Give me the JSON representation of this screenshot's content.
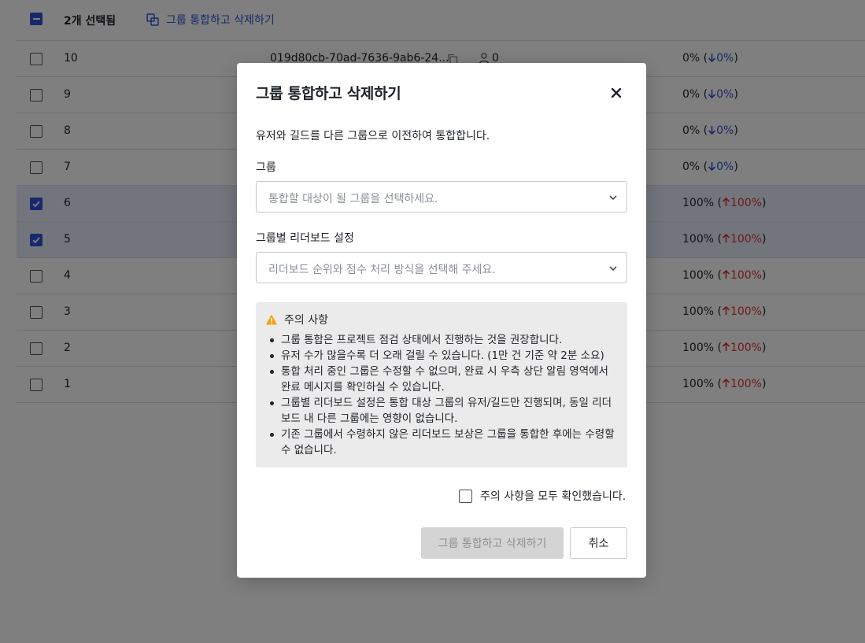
{
  "toolbar": {
    "selected_count": "2개 선택됨",
    "merge_action": "그룹 통합하고 삭제하기"
  },
  "rows": [
    {
      "num": "10",
      "uuid": "019d80cb-70ad-7636-9ab6-24...",
      "users": "0",
      "rate": "0% (",
      "change": "0%",
      "direction": "down",
      "selected": false
    },
    {
      "num": "9",
      "rate": "0% (",
      "change": "0%",
      "direction": "down",
      "selected": false
    },
    {
      "num": "8",
      "rate": "0% (",
      "change": "0%",
      "direction": "down",
      "selected": false
    },
    {
      "num": "7",
      "rate": "0% (",
      "change": "0%",
      "direction": "down",
      "selected": false
    },
    {
      "num": "6",
      "rate": "100% (",
      "change": "100%",
      "direction": "up",
      "selected": true
    },
    {
      "num": "5",
      "rate": "100% (",
      "change": "100%",
      "direction": "up",
      "selected": true
    },
    {
      "num": "4",
      "rate": "100% (",
      "change": "100%",
      "direction": "up",
      "selected": false
    },
    {
      "num": "3",
      "rate": "100% (",
      "change": "100%",
      "direction": "up",
      "selected": false
    },
    {
      "num": "2",
      "rate": "100% (",
      "change": "100%",
      "direction": "up",
      "selected": false
    },
    {
      "num": "1",
      "rate": "100% (",
      "change": "100%",
      "direction": "up",
      "selected": false
    }
  ],
  "rate_close": ")",
  "modal": {
    "title": "그룹 통합하고 삭제하기",
    "description": "유저와 길드를 다른 그룹으로 이전하여 통합합니다.",
    "group_label": "그룹",
    "group_placeholder": "통합할 대상이 될 그룹을 선택하세요.",
    "leaderboard_label": "그룹별 리더보드 설정",
    "leaderboard_placeholder": "리더보드 순위와 점수 처리 방식을 선택해 주세요.",
    "notice_title": "주의 사항",
    "notice_items": [
      "그룹 통합은 프로젝트 점검 상태에서 진행하는 것을 권장합니다.",
      "유저 수가 많을수록 더 오래 걸릴 수 있습니다. (1만 건 기준 약 2분 소요)",
      "통합 처리 중인 그룹은 수정할 수 없으며, 완료 시 우측 상단 알림 영역에서 완료 메시지를 확인하실 수 있습니다.",
      "그룹별 리더보드 설정은 통합 대상 그룹의 유저/길드만 진행되며, 동일 리더보드 내 다른 그룹에는 영향이 없습니다.",
      "기존 그룹에서 수령하지 않은 리더보드 보상은 그룹을 통합한 후에는 수령할 수 없습니다."
    ],
    "confirm_label": "주의 사항을 모두 확인했습니다.",
    "submit_label": "그룹 통합하고 삭제하기",
    "cancel_label": "취소"
  },
  "colors": {
    "accent": "#3152d6",
    "up": "#e0332d",
    "down": "#3152d6",
    "warning": "#f59e0b"
  }
}
